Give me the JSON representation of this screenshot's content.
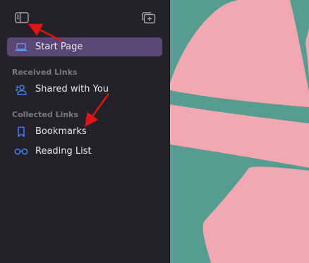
{
  "sidebar": {
    "toolbar": {
      "toggle_sidebar_icon": "sidebar-icon",
      "new_tab_group_icon": "tab-group-add-icon"
    },
    "start_page": {
      "label": "Start Page",
      "icon": "laptop-icon",
      "selected": true
    },
    "received_links": {
      "title": "Received Links",
      "items": [
        {
          "label": "Shared with You",
          "icon": "shared-people-icon"
        }
      ]
    },
    "collected_links": {
      "title": "Collected Links",
      "items": [
        {
          "label": "Bookmarks",
          "icon": "bookmark-icon"
        },
        {
          "label": "Reading List",
          "icon": "glasses-icon"
        }
      ]
    }
  },
  "colors": {
    "sidebar_bg": "#242228",
    "selection": "#5a4775",
    "accent_icon": "#3f7ff0",
    "section_title": "#7b7981",
    "wallpaper_teal": "#569c91",
    "wallpaper_pink": "#f2a8b1",
    "annotation_arrow": "#e01414"
  }
}
